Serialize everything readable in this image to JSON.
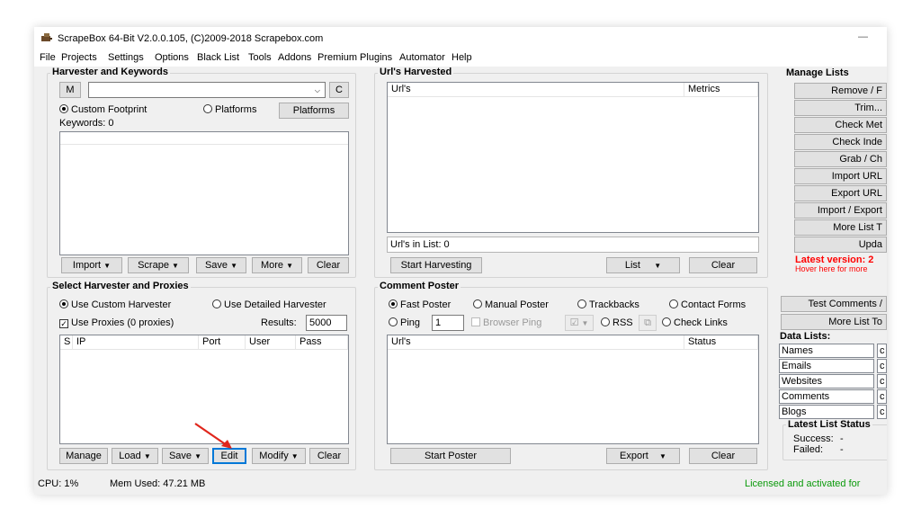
{
  "window": {
    "title": "ScrapeBox 64-Bit V2.0.0.105, (C)2009-2018 Scrapebox.com",
    "minimize": "—"
  },
  "menu": [
    "File",
    "Projects",
    "Settings",
    "Options",
    "Black List",
    "Tools",
    "Addons",
    "Premium Plugins",
    "Automator",
    "Help"
  ],
  "harvester": {
    "title": "Harvester and Keywords",
    "m_button": "M",
    "c_button": "C",
    "custom_footprint": "Custom Footprint",
    "platforms_radio": "Platforms",
    "platforms_button": "Platforms",
    "keywords_label": "Keywords:  0",
    "buttons": [
      "Import",
      "Scrape",
      "Save",
      "More",
      "Clear"
    ]
  },
  "urls_harvested": {
    "title": "Url's Harvested",
    "col_url": "Url's",
    "col_metrics": "Metrics",
    "count_label": "Url's in List: 0",
    "start_button": "Start Harvesting",
    "list_button": "List",
    "clear_button": "Clear"
  },
  "manage_lists": {
    "title": "Manage Lists",
    "buttons": [
      "Remove / F",
      "Trim...",
      "Check Met",
      "Check Inde",
      "Grab / Ch",
      "Import URL",
      "Export URL",
      "Import / Export",
      "More List T",
      "Upda"
    ],
    "latest_version": "Latest version: 2",
    "hover_note": "Hover here for more"
  },
  "select_harvester": {
    "title": "Select Harvester and Proxies",
    "custom_harvester": "Use Custom Harvester",
    "detailed_harvester": "Use Detailed Harvester",
    "use_proxies": "Use Proxies  (0 proxies)",
    "results_label": "Results:",
    "results_value": "5000",
    "columns": [
      "S",
      "IP",
      "Port",
      "User",
      "Pass"
    ],
    "buttons": [
      "Manage",
      "Load",
      "Save",
      "Edit",
      "Modify",
      "Clear"
    ]
  },
  "comment_poster": {
    "title": "Comment Poster",
    "fast_poster": "Fast Poster",
    "manual_poster": "Manual Poster",
    "trackbacks": "Trackbacks",
    "contact_forms": "Contact Forms",
    "ping": "Ping",
    "ping_value": "1",
    "browser_ping": "Browser Ping",
    "rss": "RSS",
    "check_links": "Check Links",
    "col_url": "Url's",
    "col_status": "Status",
    "start_button": "Start Poster",
    "export_button": "Export",
    "clear_button": "Clear"
  },
  "right_lower": {
    "test_comments": "Test Comments /",
    "more_list_tools": "More List To",
    "data_lists_title": "Data Lists:",
    "data_lists": [
      "Names",
      "Emails",
      "Websites",
      "Comments",
      "Blogs"
    ],
    "data_list_extra": "c",
    "latest_status_title": "Latest List Status",
    "success_label": "Success:",
    "success_value": "-",
    "failed_label": "Failed:",
    "failed_value": "-"
  },
  "statusbar": {
    "cpu": "CPU:  1%",
    "mem": "Mem Used: 47.21 MB",
    "license": "Licensed and activated for"
  },
  "colors": {
    "accent": "#0078d7",
    "alert": "#ff0000",
    "license_green": "#0a9a0a",
    "annotation_arrow": "#e0261c"
  }
}
